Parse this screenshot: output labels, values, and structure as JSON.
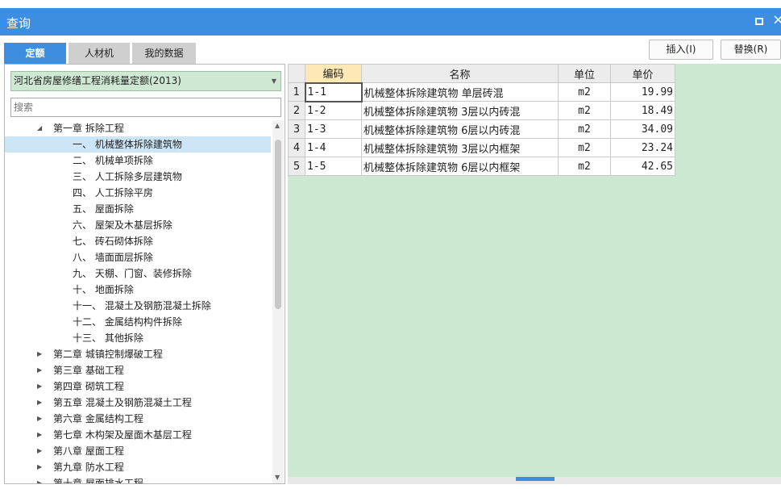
{
  "window": {
    "title": "查询",
    "maximize_icon": "maximize-icon",
    "close_icon": "close-icon",
    "close_glyph": "×"
  },
  "tabs": [
    {
      "label": "定额",
      "active": true
    },
    {
      "label": "人材机",
      "active": false
    },
    {
      "label": "我的数据",
      "active": false
    }
  ],
  "buttons": {
    "insert": "插入(I)",
    "replace": "替换(R)"
  },
  "library": {
    "selected": "河北省房屋修缮工程消耗量定额(2013)"
  },
  "search": {
    "placeholder": "搜索"
  },
  "tree": [
    {
      "text": "第一章  拆除工程",
      "level": 1,
      "expanded": true,
      "selected": false
    },
    {
      "text": "一、  机械整体拆除建筑物",
      "level": 2,
      "expanded": false,
      "selected": true
    },
    {
      "text": "二、  机械单项拆除",
      "level": 2,
      "expanded": false,
      "selected": false
    },
    {
      "text": "三、  人工拆除多层建筑物",
      "level": 2,
      "expanded": false,
      "selected": false
    },
    {
      "text": "四、  人工拆除平房",
      "level": 2,
      "expanded": false,
      "selected": false
    },
    {
      "text": "五、  屋面拆除",
      "level": 2,
      "expanded": false,
      "selected": false
    },
    {
      "text": "六、  屋架及木基层拆除",
      "level": 2,
      "expanded": false,
      "selected": false
    },
    {
      "text": "七、  砖石砌体拆除",
      "level": 2,
      "expanded": false,
      "selected": false
    },
    {
      "text": "八、  墙面面层拆除",
      "level": 2,
      "expanded": false,
      "selected": false
    },
    {
      "text": "九、  天棚、门窗、装修拆除",
      "level": 2,
      "expanded": false,
      "selected": false
    },
    {
      "text": "十、  地面拆除",
      "level": 2,
      "expanded": false,
      "selected": false
    },
    {
      "text": "十一、  混凝土及钢筋混凝土拆除",
      "level": 2,
      "expanded": false,
      "selected": false
    },
    {
      "text": "十二、  金属结构构件拆除",
      "level": 2,
      "expanded": false,
      "selected": false
    },
    {
      "text": "十三、  其他拆除",
      "level": 2,
      "expanded": false,
      "selected": false
    },
    {
      "text": "第二章  城镇控制爆破工程",
      "level": 1,
      "expanded": false,
      "selected": false
    },
    {
      "text": "第三章  基础工程",
      "level": 1,
      "expanded": false,
      "selected": false
    },
    {
      "text": "第四章  砌筑工程",
      "level": 1,
      "expanded": false,
      "selected": false
    },
    {
      "text": "第五章  混凝土及钢筋混凝土工程",
      "level": 1,
      "expanded": false,
      "selected": false
    },
    {
      "text": "第六章  金属结构工程",
      "level": 1,
      "expanded": false,
      "selected": false
    },
    {
      "text": "第七章  木构架及屋面木基层工程",
      "level": 1,
      "expanded": false,
      "selected": false
    },
    {
      "text": "第八章  屋面工程",
      "level": 1,
      "expanded": false,
      "selected": false
    },
    {
      "text": "第九章  防水工程",
      "level": 1,
      "expanded": false,
      "selected": false
    },
    {
      "text": "第十章  屋面排水工程",
      "level": 1,
      "expanded": false,
      "selected": false
    }
  ],
  "table": {
    "columns": [
      "编码",
      "名称",
      "单位",
      "单价"
    ],
    "rows": [
      {
        "index": "1",
        "code": "1-1",
        "name": "机械整体拆除建筑物 单层砖混",
        "unit": "m2",
        "price": "19.99"
      },
      {
        "index": "2",
        "code": "1-2",
        "name": "机械整体拆除建筑物 3层以内砖混",
        "unit": "m2",
        "price": "18.49"
      },
      {
        "index": "3",
        "code": "1-3",
        "name": "机械整体拆除建筑物 6层以内砖混",
        "unit": "m2",
        "price": "34.09"
      },
      {
        "index": "4",
        "code": "1-4",
        "name": "机械整体拆除建筑物 3层以内框架",
        "unit": "m2",
        "price": "23.24"
      },
      {
        "index": "5",
        "code": "1-5",
        "name": "机械整体拆除建筑物 6层以内框架",
        "unit": "m2",
        "price": "42.65"
      }
    ]
  },
  "colors": {
    "accent": "#3d8ee0",
    "grid_bg": "#cde8d1",
    "selected_row": "#cde6f7",
    "header_selected": "#fde8b6"
  }
}
